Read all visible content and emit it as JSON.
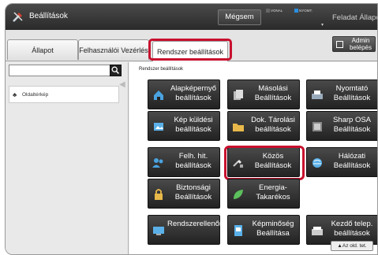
{
  "titlebar": {
    "title": "Beállítások",
    "cancel_label": "Mégsem",
    "indicator_vonal": "VONAL",
    "indicator_nyomt": "NYOMT.",
    "status_field": "Feladat Állapota"
  },
  "tabs": [
    {
      "label": "Állapot"
    },
    {
      "label": "Felhasználói Vezérlés"
    },
    {
      "label": "Rendszer beállítások"
    }
  ],
  "admin_button": {
    "label": "Admin belépés"
  },
  "sidebar": {
    "search_placeholder": "",
    "sitemap_label": "Oldaltérkép"
  },
  "main": {
    "breadcrumb": "Rendszer beállítások",
    "buttons": [
      {
        "label": "Alapképernyő beállítások",
        "icon": "home-icon"
      },
      {
        "label": "Másolási Beállítások",
        "icon": "copy-icon"
      },
      {
        "label": "Nyomtató Beállítások",
        "icon": "printer-icon"
      },
      {
        "label": "Kép küldési beállítások",
        "icon": "image-send-icon"
      },
      {
        "label": "Dok. Tárolási beállítások",
        "icon": "folder-icon"
      },
      {
        "label": "Sharp OSA Beállítások",
        "icon": "osa-icon"
      },
      {
        "label": "Felh. hit. beállítások",
        "icon": "users-icon"
      },
      {
        "label": "Közös Beállítások",
        "icon": "common-settings-icon"
      },
      {
        "label": "Hálózati Beállítások",
        "icon": "network-icon"
      },
      {
        "label": "Biztonsági Beállítások",
        "icon": "lock-icon"
      },
      {
        "label": "Energia-Takarékos",
        "icon": "leaf-icon"
      },
      {
        "label": "Rendszerellenőrzés",
        "icon": "system-check-icon"
      },
      {
        "label": "Képminőség Beállítása",
        "icon": "image-quality-icon"
      },
      {
        "label": "Kezdő telep. beállítások",
        "icon": "initial-setup-icon"
      }
    ],
    "back_label": "Az old. tet."
  }
}
